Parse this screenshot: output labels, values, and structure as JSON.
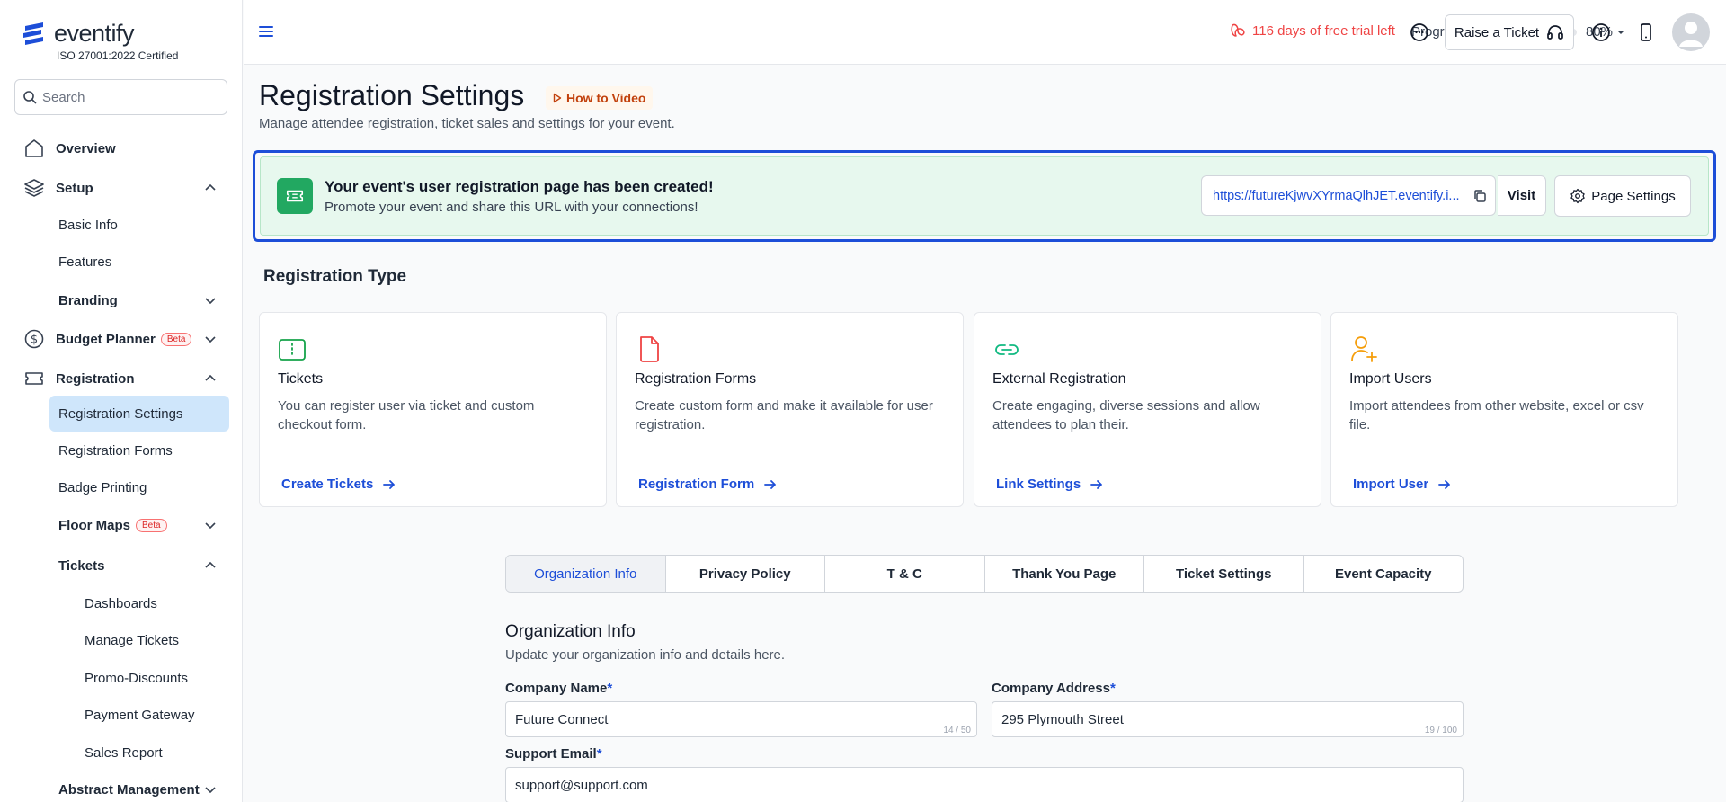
{
  "brand": {
    "name": "eventify",
    "certification": "ISO 27001:2022 Certified"
  },
  "sidebar": {
    "search_placeholder": "Search",
    "overview": "Overview",
    "setup": "Setup",
    "basic_info": "Basic Info",
    "features": "Features",
    "branding": "Branding",
    "budget_planner": "Budget Planner",
    "beta": "Beta",
    "registration": "Registration",
    "registration_settings": "Registration Settings",
    "registration_forms": "Registration Forms",
    "badge_printing": "Badge Printing",
    "floor_maps": "Floor Maps",
    "tickets": "Tickets",
    "dashboards": "Dashboards",
    "manage_tickets": "Manage Tickets",
    "promo_discounts": "Promo-Discounts",
    "payment_gateway": "Payment Gateway",
    "sales_report": "Sales Report",
    "abstract_management": "Abstract Management"
  },
  "header": {
    "trial_text": "116 days of free trial left",
    "progress_label": "Progress",
    "progress_value": "80%",
    "progress_fraction": 0.8,
    "raise_ticket": "Raise a Ticket"
  },
  "page": {
    "title": "Registration Settings",
    "how_to_video": "How to Video",
    "subtitle": "Manage attendee registration, ticket sales and settings for your event."
  },
  "banner": {
    "title": "Your event's user registration page has been created!",
    "subtitle": "Promote your event and share this URL with your connections!",
    "url": "https://futureKjwvXYrmaQlhJET.eventify.i...",
    "visit": "Visit",
    "page_settings": "Page Settings"
  },
  "registration_type": {
    "title": "Registration Type",
    "cards": [
      {
        "title": "Tickets",
        "desc": "You can register user via ticket and custom checkout form.",
        "link": "Create Tickets",
        "icon": "ticket-icon"
      },
      {
        "title": "Registration Forms",
        "desc": "Create custom form and make it available for user registration.",
        "link": "Registration Form",
        "icon": "file-icon"
      },
      {
        "title": "External Registration",
        "desc": "Create engaging, diverse sessions and allow attendees to plan their.",
        "link": "Link Settings",
        "icon": "link-icon"
      },
      {
        "title": "Import Users",
        "desc": "Import attendees from other website, excel or csv file.",
        "link": "Import User",
        "icon": "user-plus-icon"
      }
    ]
  },
  "tabs": [
    "Organization Info",
    "Privacy Policy",
    "T & C",
    "Thank You Page",
    "Ticket Settings",
    "Event Capacity"
  ],
  "form": {
    "title": "Organization Info",
    "subtitle": "Update your organization info and details here.",
    "company_name_label": "Company Name",
    "company_name_value": "Future Connect",
    "company_name_counter": "14 / 50",
    "company_address_label": "Company Address",
    "company_address_value": "295 Plymouth Street",
    "company_address_counter": "19 / 100",
    "support_email_label": "Support Email",
    "support_email_value": "support@support.com",
    "required_mark": "*"
  },
  "colors": {
    "accent": "#1d4ed8",
    "success": "#22a861",
    "danger": "#ef4444",
    "active_nav": "#cfe6fb"
  }
}
